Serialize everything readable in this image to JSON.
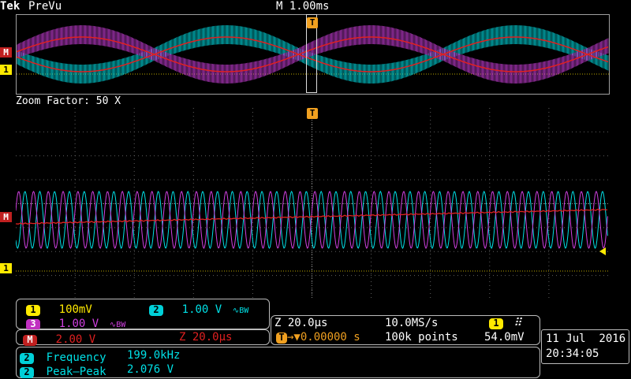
{
  "header": {
    "brand": "Tek",
    "mode": "PreVu",
    "timebase": "M 1.00ms"
  },
  "overview": {
    "trigger_marker": "T",
    "math_marker": "M",
    "ch1_marker": "1"
  },
  "zoom": {
    "title": "Zoom Factor: 50 X",
    "trigger_marker": "T",
    "math_marker": "M",
    "ch1_marker": "1"
  },
  "channels": {
    "ch1": {
      "num": "1",
      "scale": "100mV"
    },
    "ch2": {
      "num": "2",
      "scale": "1.00 V",
      "bw": "∿BW"
    },
    "ch3": {
      "num": "3",
      "scale": "1.00 V",
      "bw": "∿BW"
    },
    "math": {
      "num": "M",
      "scale": "2.00 V",
      "zoom": "Z 20.0µs"
    }
  },
  "horizontal": {
    "zoom_time": "Z 20.0µs",
    "sample_rate": "10.0MS/s",
    "trigger_label": "T",
    "trigger_offset": "→▼0.00000 s",
    "record": "100k points",
    "trigger_source": "1",
    "trigger_level": "54.0mV"
  },
  "measurements": [
    {
      "ch": "2",
      "name": "Frequency",
      "value": "199.0kHz"
    },
    {
      "ch": "2",
      "name": "Peak–Peak",
      "value": "2.076 V"
    }
  ],
  "datetime": {
    "date": "11 Jul  2016",
    "time": "20:34:05"
  },
  "colors": {
    "ch1": "#ffea00",
    "ch2": "#00e0e6",
    "ch3": "#d040e0",
    "math": "#e02020",
    "grid": "#606060"
  }
}
